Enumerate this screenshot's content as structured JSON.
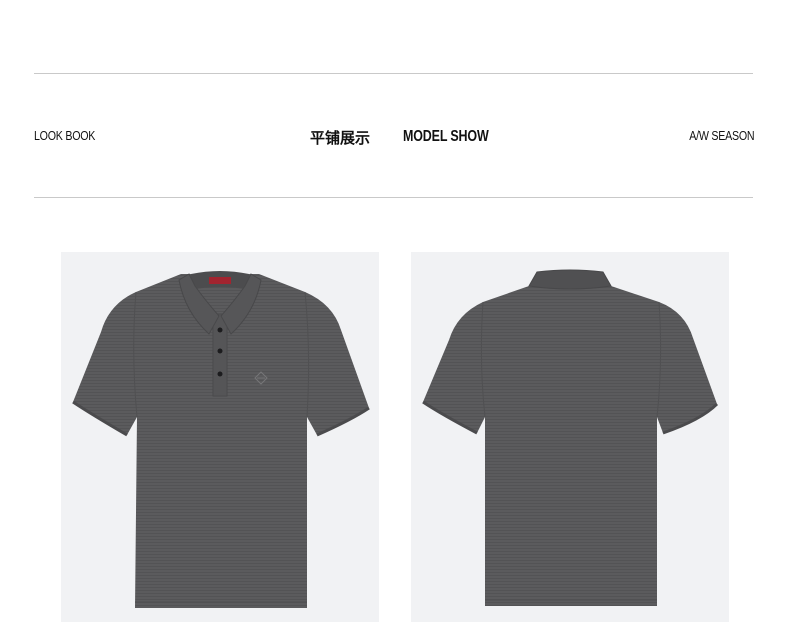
{
  "header": {
    "left_label": "LOOK BOOK",
    "title_cn": "平铺展示",
    "separator": "|",
    "title_en": "MODEL SHOW",
    "right_label": "A/W SEASON"
  },
  "products": [
    {
      "view": "front",
      "color": "#5a5a5c"
    },
    {
      "view": "back",
      "color": "#5a5a5c"
    }
  ],
  "colors": {
    "background": "#ffffff",
    "photo_background": "#f1f2f4",
    "rule": "#c9c9c9",
    "shirt": "#5a5a5c",
    "label_accent": "#a2242f"
  }
}
